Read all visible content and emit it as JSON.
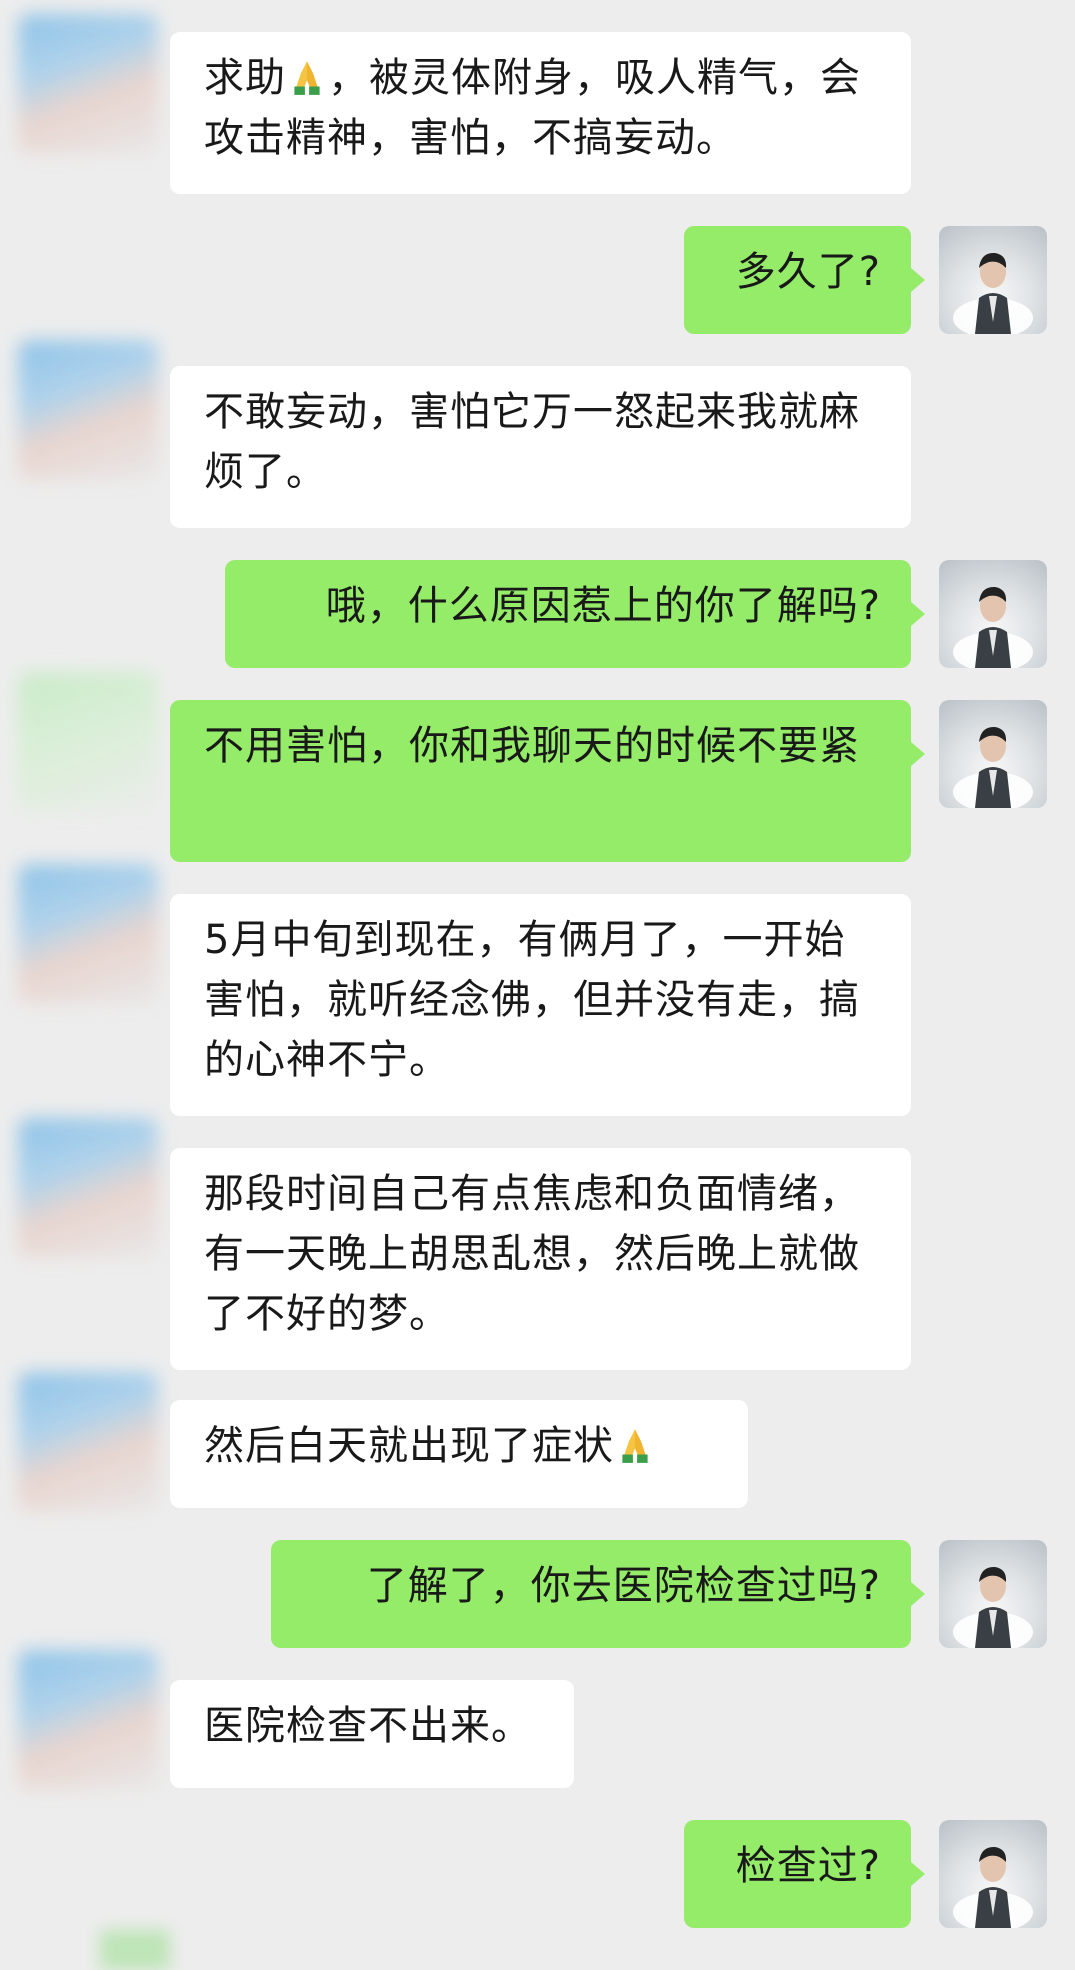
{
  "messages": [
    {
      "side": "left",
      "text": "求助",
      "emoji": "folded-hands-icon",
      "text_after": "，被灵体附身，吸人精气，会攻击精神，害怕，不搞妄动。"
    },
    {
      "side": "right",
      "text": "多久了?"
    },
    {
      "side": "left",
      "text": "不敢妄动，害怕它万一怒起来我就麻烦了。"
    },
    {
      "side": "right",
      "text": "哦，什么原因惹上的你了解吗?"
    },
    {
      "side": "right",
      "text": "不用害怕，你和我聊天的时候不要紧"
    },
    {
      "side": "left",
      "text": "5月中旬到现在，有俩月了，一开始害怕，就听经念佛，但并没有走，搞的心神不宁。"
    },
    {
      "side": "left",
      "text": "那段时间自己有点焦虑和负面情绪，有一天晚上胡思乱想，然后晚上就做了不好的梦。"
    },
    {
      "side": "left",
      "text": "然后白天就出现了症状",
      "emoji": "folded-hands-icon"
    },
    {
      "side": "right",
      "text": "了解了，你去医院检查过吗?"
    },
    {
      "side": "left",
      "text": "医院检查不出来。"
    },
    {
      "side": "right",
      "text": "检查过?"
    }
  ],
  "colors": {
    "background": "#ededed",
    "incoming_bubble": "#ffffff",
    "outgoing_bubble": "#95ec69",
    "text": "#191919"
  }
}
